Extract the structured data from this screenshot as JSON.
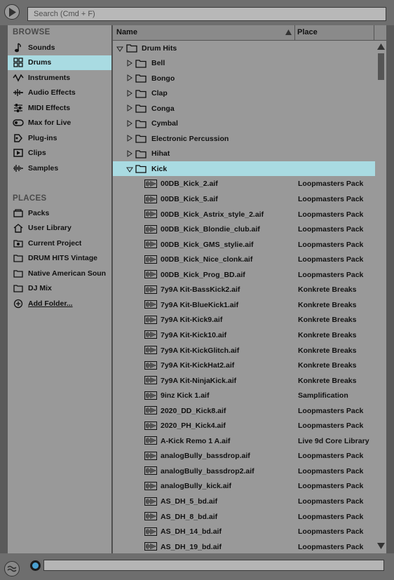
{
  "search": {
    "placeholder": "Search (Cmd + F)"
  },
  "sidebar": {
    "browse_heading": "BROWSE",
    "browse_items": [
      {
        "label": "Sounds",
        "icon": "note-icon"
      },
      {
        "label": "Drums",
        "icon": "drum-grid-icon",
        "selected": true
      },
      {
        "label": "Instruments",
        "icon": "waveform-icon"
      },
      {
        "label": "Audio Effects",
        "icon": "audio-effects-icon"
      },
      {
        "label": "MIDI Effects",
        "icon": "midi-effects-icon"
      },
      {
        "label": "Max for Live",
        "icon": "max-for-live-icon"
      },
      {
        "label": "Plug-ins",
        "icon": "plugin-icon"
      },
      {
        "label": "Clips",
        "icon": "clip-icon"
      },
      {
        "label": "Samples",
        "icon": "sample-icon"
      }
    ],
    "places_heading": "PLACES",
    "places_items": [
      {
        "label": "Packs",
        "icon": "packs-icon"
      },
      {
        "label": "User Library",
        "icon": "home-icon"
      },
      {
        "label": "Current Project",
        "icon": "project-icon"
      },
      {
        "label": "DRUM HITS Vintage",
        "icon": "folder-icon"
      },
      {
        "label": "Native American Soun",
        "icon": "folder-icon"
      },
      {
        "label": "DJ Mix",
        "icon": "folder-icon"
      },
      {
        "label": "Add Folder...",
        "icon": "add-icon"
      }
    ]
  },
  "columns": {
    "name": "Name",
    "place": "Place"
  },
  "tree": {
    "root": "Drum Hits",
    "folders": [
      "Bell",
      "Bongo",
      "Clap",
      "Conga",
      "Cymbal",
      "Electronic Percussion",
      "Hihat"
    ],
    "open_folder": "Kick",
    "files": [
      {
        "name": "00DB_Kick_2.aif",
        "place": "Loopmasters Pack"
      },
      {
        "name": "00DB_Kick_5.aif",
        "place": "Loopmasters Pack"
      },
      {
        "name": "00DB_Kick_Astrix_style_2.aif",
        "place": "Loopmasters Pack"
      },
      {
        "name": "00DB_Kick_Blondie_club.aif",
        "place": "Loopmasters Pack"
      },
      {
        "name": "00DB_Kick_GMS_stylie.aif",
        "place": "Loopmasters Pack"
      },
      {
        "name": "00DB_Kick_Nice_clonk.aif",
        "place": "Loopmasters Pack"
      },
      {
        "name": "00DB_Kick_Prog_BD.aif",
        "place": "Loopmasters Pack"
      },
      {
        "name": "7y9A Kit-BassKick2.aif",
        "place": "Konkrete Breaks"
      },
      {
        "name": "7y9A Kit-BlueKick1.aif",
        "place": "Konkrete Breaks"
      },
      {
        "name": "7y9A Kit-Kick9.aif",
        "place": "Konkrete Breaks"
      },
      {
        "name": "7y9A Kit-Kick10.aif",
        "place": "Konkrete Breaks"
      },
      {
        "name": "7y9A Kit-KickGlitch.aif",
        "place": "Konkrete Breaks"
      },
      {
        "name": "7y9A Kit-KickHat2.aif",
        "place": "Konkrete Breaks"
      },
      {
        "name": "7y9A Kit-NinjaKick.aif",
        "place": "Konkrete Breaks"
      },
      {
        "name": "9inz Kick 1.aif",
        "place": "Samplification"
      },
      {
        "name": "2020_DD_Kick8.aif",
        "place": "Loopmasters Pack"
      },
      {
        "name": "2020_PH_Kick4.aif",
        "place": "Loopmasters Pack"
      },
      {
        "name": "A-Kick Remo 1 A.aif",
        "place": "Live 9d Core Library"
      },
      {
        "name": "analogBully_bassdrop.aif",
        "place": "Loopmasters Pack"
      },
      {
        "name": "analogBully_bassdrop2.aif",
        "place": "Loopmasters Pack"
      },
      {
        "name": "analogBully_kick.aif",
        "place": "Loopmasters Pack"
      },
      {
        "name": "AS_DH_5_bd.aif",
        "place": "Loopmasters Pack"
      },
      {
        "name": "AS_DH_8_bd.aif",
        "place": "Loopmasters Pack"
      },
      {
        "name": "AS_DH_14_bd.aif",
        "place": "Loopmasters Pack"
      },
      {
        "name": "AS_DH_19_bd.aif",
        "place": "Loopmasters Pack"
      }
    ]
  },
  "colors": {
    "selection": "#a9dbe2",
    "panel": "#999999",
    "frame": "#5a5a5a"
  }
}
